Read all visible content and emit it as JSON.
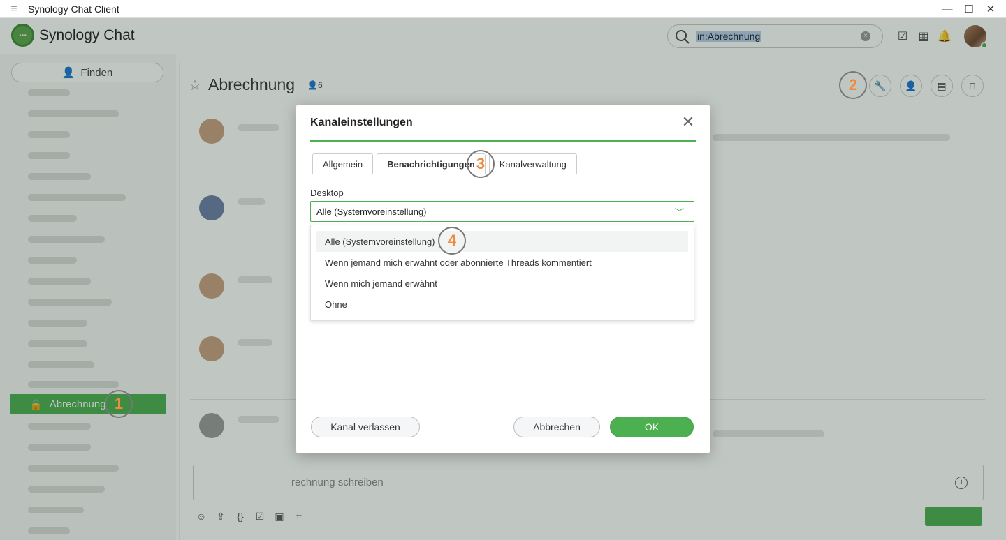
{
  "window": {
    "title": "Synology Chat Client"
  },
  "header": {
    "app_name": "Synology Chat",
    "search_value": "in:Abrechnung"
  },
  "sidebar": {
    "find_label": "Finden",
    "active_channel": "Abrechnung"
  },
  "channel": {
    "title": "Abrechnung",
    "member_count": "6",
    "composer_placeholder": "rechnung schreiben"
  },
  "dialog": {
    "title": "Kanaleinstellungen",
    "tabs": [
      "Allgemein",
      "Benachrichtigungen",
      "Kanalverwaltung"
    ],
    "field_label": "Desktop",
    "selected_value": "Alle (Systemvoreinstellung)",
    "options": [
      "Alle (Systemvoreinstellung)",
      "Wenn jemand mich erwähnt oder abonnierte Threads kommentiert",
      "Wenn mich jemand erwähnt",
      "Ohne"
    ],
    "leave_button": "Kanal verlassen",
    "cancel_button": "Abbrechen",
    "ok_button": "OK"
  },
  "markers": [
    "1",
    "2",
    "3",
    "4"
  ],
  "colors": {
    "accent": "#4caf50",
    "marker_text": "#f08a3c"
  }
}
